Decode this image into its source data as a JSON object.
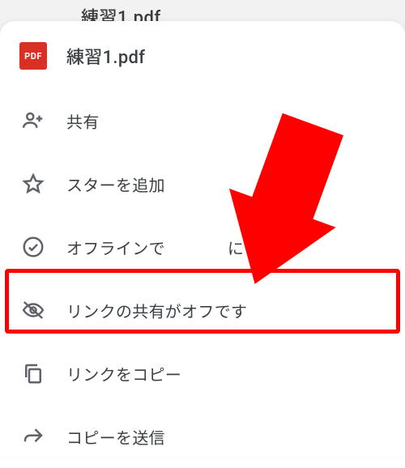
{
  "backdrop": {
    "text": "練習1.pdf"
  },
  "file": {
    "badge": "PDF",
    "name": "練習1.pdf"
  },
  "menu": {
    "share": "共有",
    "star": "スターを追加",
    "offline_prefix": "オフラインで",
    "offline_suffix": "にする",
    "link_sharing_off": "リンクの共有がオフです",
    "copy_link": "リンクをコピー",
    "send_copy": "コピーを送信"
  }
}
